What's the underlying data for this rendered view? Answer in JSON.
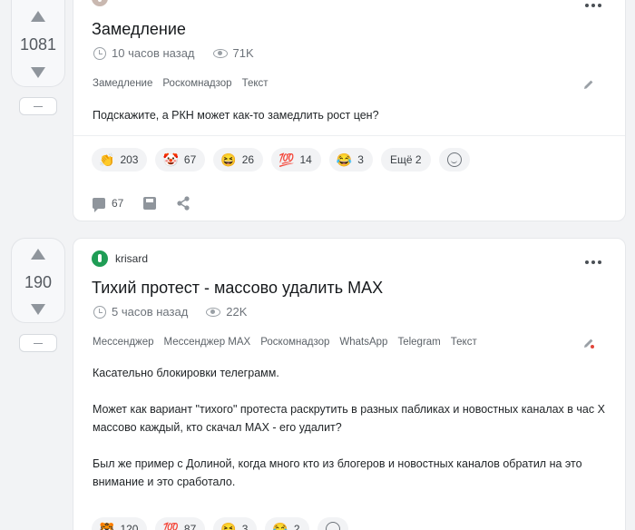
{
  "posts": [
    {
      "rating": "1081",
      "author": "",
      "title": "Замедление",
      "time": "10 часов назад",
      "views": "71K",
      "tags": [
        "Замедление",
        "Роскомнадзор",
        "Текст"
      ],
      "text": [
        "Подскажите, а РКН может как-то замедлить рост цен?"
      ],
      "reactions": [
        {
          "emoji": "👏",
          "count": "203"
        },
        {
          "emoji": "🤡",
          "count": "67"
        },
        {
          "emoji": "😆",
          "count": "26"
        },
        {
          "emoji": "💯",
          "count": "14"
        },
        {
          "emoji": "😂",
          "count": "3"
        }
      ],
      "more_reactions": "Ещё 2",
      "comments": "67"
    },
    {
      "rating": "190",
      "author": "krisard",
      "title": "Тихий протест - массово удалить MAX",
      "time": "5 часов назад",
      "views": "22K",
      "tags": [
        "Мессенджер",
        "Мессенджер MAX",
        "Роскомнадзор",
        "WhatsApp",
        "Telegram",
        "Текст"
      ],
      "text": [
        "Касательно блокировки телеграмм.",
        "Может как вариант \"тихого\" протеста раскрутить в разных пабликах и новостных каналах в час Х массово каждый, кто скачал MAX - его удалит?",
        "Был же пример с Долиной, когда много кто из блогеров и новостных каналов обратил на это внимание и это сработало."
      ],
      "reactions": [
        {
          "emoji": "🐯",
          "count": "120"
        },
        {
          "emoji": "💯",
          "count": "87"
        },
        {
          "emoji": "😆",
          "count": "3"
        },
        {
          "emoji": "😂",
          "count": "2"
        }
      ]
    }
  ]
}
